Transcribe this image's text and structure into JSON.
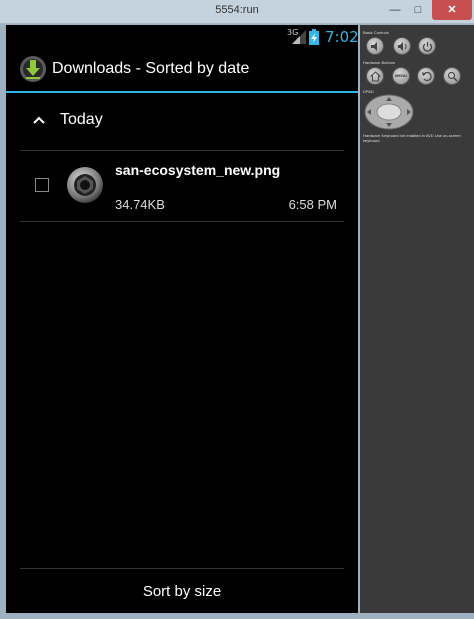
{
  "window": {
    "title": "5554:run",
    "minimize_glyph": "—",
    "maximize_glyph": "□",
    "close_glyph": "✕"
  },
  "statusbar": {
    "network": "3G",
    "time": "7:02"
  },
  "actionbar": {
    "title": "Downloads - Sorted by date",
    "icon": "download-icon"
  },
  "group": {
    "label": "Today"
  },
  "downloads": [
    {
      "name": "san-ecosystem_new.png",
      "size": "34.74KB",
      "time": "6:58 PM",
      "icon": "image-file-icon"
    }
  ],
  "bottom": {
    "sort_label": "Sort by size"
  },
  "controls": {
    "basic_label": "Basic Controls",
    "hardware_label": "Hardware Buttons",
    "menu_label": "MENU",
    "dpad_label": "DPAD",
    "keyboard_note": "Hardware Keyboard not enabled in AVD Use on-screen keyboard"
  },
  "colors": {
    "accent": "#33b5e5",
    "background": "#000000"
  }
}
